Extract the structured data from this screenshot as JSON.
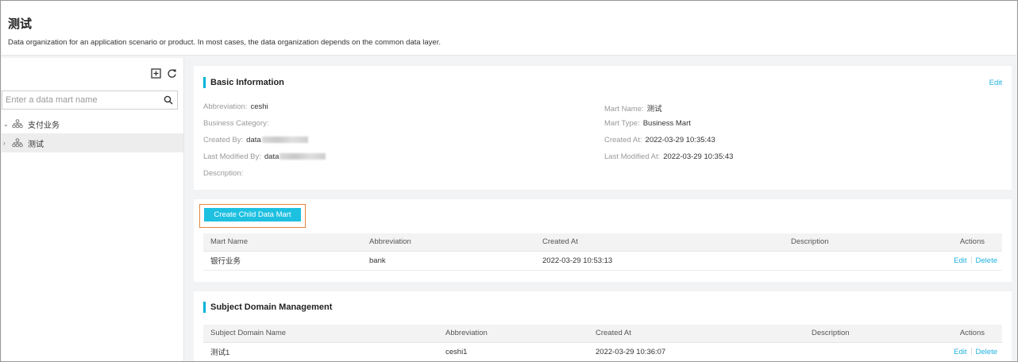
{
  "header": {
    "title": "测试",
    "description": "Data organization for an application scenario or product. In most cases, the data organization depends on the common data layer."
  },
  "sidebar": {
    "search_placeholder": "Enter a data mart name",
    "tree": [
      {
        "label": "支付业务",
        "expanded": true,
        "selected": false,
        "icon": "hierarchy-icon"
      },
      {
        "label": "测试",
        "expanded": false,
        "selected": true,
        "icon": "hierarchy-icon"
      }
    ]
  },
  "basic_info": {
    "title": "Basic Information",
    "edit_label": "Edit",
    "left": [
      {
        "label": "Abbreviation:",
        "value": "ceshi"
      },
      {
        "label": "Business Category:",
        "value": ""
      },
      {
        "label": "Created By:",
        "value": "data"
      },
      {
        "label": "Last Modified By:",
        "value": "data"
      },
      {
        "label": "Description:",
        "value": ""
      }
    ],
    "right": [
      {
        "label": "Mart Name:",
        "value": "测试"
      },
      {
        "label": "Mart Type:",
        "value": "Business Mart"
      },
      {
        "label": "Created At:",
        "value": "2022-03-29 10:35:43"
      },
      {
        "label": "Last Modified At:",
        "value": "2022-03-29 10:35:43"
      }
    ]
  },
  "child_marts": {
    "create_button": "Create Child Data Mart",
    "columns": [
      "Mart Name",
      "Abbreviation",
      "Created At",
      "Description",
      "Actions"
    ],
    "rows": [
      {
        "name": "银行业务",
        "abbreviation": "bank",
        "created_at": "2022-03-29 10:53:13",
        "description": "",
        "edit": "Edit",
        "delete": "Delete"
      }
    ]
  },
  "subject_domain": {
    "title": "Subject Domain Management",
    "columns": [
      "Subject Domain Name",
      "Abbreviation",
      "Created At",
      "Description",
      "Actions"
    ],
    "rows": [
      {
        "name": "测试1",
        "abbreviation": "ceshi1",
        "created_at": "2022-03-29 10:36:07",
        "description": "",
        "edit": "Edit",
        "delete": "Delete"
      }
    ]
  },
  "colors": {
    "accent": "#1ec0e0",
    "link": "#1fb1e0",
    "highlight_border": "#e8863a"
  }
}
